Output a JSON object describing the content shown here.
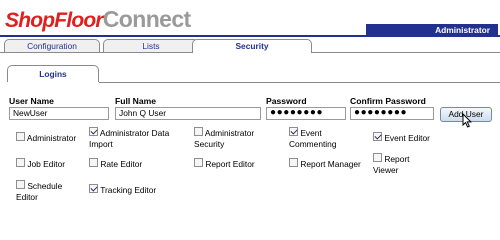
{
  "app": {
    "logo_part1": "ShopFloor",
    "logo_part2": "Connect",
    "role": "Administrator"
  },
  "tabs": [
    {
      "label": "Configuration",
      "active": false
    },
    {
      "label": "Lists",
      "active": false
    },
    {
      "label": "Security",
      "active": true
    }
  ],
  "subtab": {
    "label": "Logins"
  },
  "form": {
    "user_name": {
      "label": "User Name",
      "value": "NewUser"
    },
    "full_name": {
      "label": "Full Name",
      "value": "John Q User"
    },
    "password": {
      "label": "Password",
      "value": "●●●●●●●●"
    },
    "confirm_password": {
      "label": "Confirm Password",
      "value": "●●●●●●●●"
    },
    "add_button": "Add User"
  },
  "permissions": [
    {
      "line1": "Administrator",
      "line2": "",
      "checked": false
    },
    {
      "line1": "Administrator Data",
      "line2": "Import",
      "checked": true
    },
    {
      "line1": "Administrator",
      "line2": "Security",
      "checked": false
    },
    {
      "line1": "Event",
      "line2": "Commenting",
      "checked": true
    },
    {
      "line1": "Event Editor",
      "line2": "",
      "checked": true
    },
    {
      "line1": "Job Editor",
      "line2": "",
      "checked": false
    },
    {
      "line1": "Rate Editor",
      "line2": "",
      "checked": false
    },
    {
      "line1": "Report Editor",
      "line2": "",
      "checked": false
    },
    {
      "line1": "Report Manager",
      "line2": "",
      "checked": false
    },
    {
      "line1": "Report",
      "line2": "Viewer",
      "checked": false
    },
    {
      "line1": "Schedule",
      "line2": "Editor",
      "checked": false
    },
    {
      "line1": "Tracking Editor",
      "line2": "",
      "checked": true
    }
  ],
  "colors": {
    "brand_red": "#e01f1f",
    "brand_gray": "#9a9a9a",
    "nav_blue": "#22318e"
  }
}
